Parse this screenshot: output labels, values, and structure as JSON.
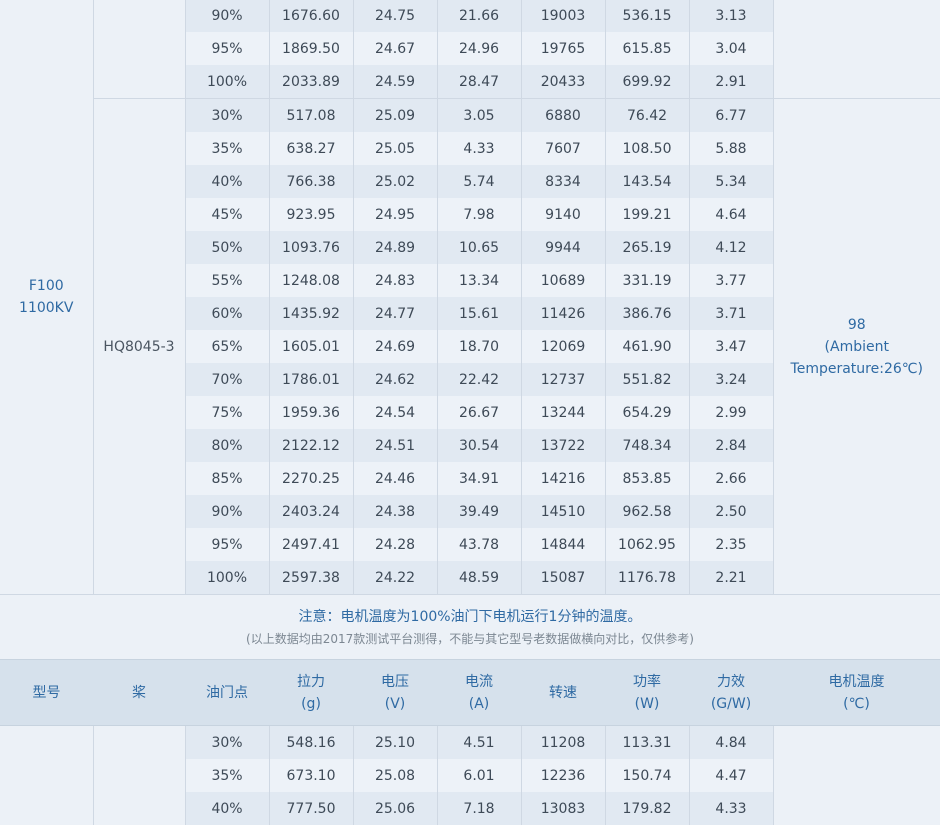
{
  "group1": {
    "motor_line1": "F100",
    "motor_line2": "1100KV",
    "rows_a": [
      {
        "throttle": "90%",
        "thrust": "1676.60",
        "voltage": "24.75",
        "current": "21.66",
        "rpm": "19003",
        "power": "536.15",
        "eff": "3.13"
      },
      {
        "throttle": "95%",
        "thrust": "1869.50",
        "voltage": "24.67",
        "current": "24.96",
        "rpm": "19765",
        "power": "615.85",
        "eff": "3.04"
      },
      {
        "throttle": "100%",
        "thrust": "2033.89",
        "voltage": "24.59",
        "current": "28.47",
        "rpm": "20433",
        "power": "699.92",
        "eff": "2.91"
      }
    ],
    "prop_b": "HQ8045-3",
    "temp_b_line1": "98",
    "temp_b_line2": "(Ambient",
    "temp_b_line3": "Temperature:26℃)",
    "rows_b": [
      {
        "throttle": "30%",
        "thrust": "517.08",
        "voltage": "25.09",
        "current": "3.05",
        "rpm": "6880",
        "power": "76.42",
        "eff": "6.77"
      },
      {
        "throttle": "35%",
        "thrust": "638.27",
        "voltage": "25.05",
        "current": "4.33",
        "rpm": "7607",
        "power": "108.50",
        "eff": "5.88"
      },
      {
        "throttle": "40%",
        "thrust": "766.38",
        "voltage": "25.02",
        "current": "5.74",
        "rpm": "8334",
        "power": "143.54",
        "eff": "5.34"
      },
      {
        "throttle": "45%",
        "thrust": "923.95",
        "voltage": "24.95",
        "current": "7.98",
        "rpm": "9140",
        "power": "199.21",
        "eff": "4.64"
      },
      {
        "throttle": "50%",
        "thrust": "1093.76",
        "voltage": "24.89",
        "current": "10.65",
        "rpm": "9944",
        "power": "265.19",
        "eff": "4.12"
      },
      {
        "throttle": "55%",
        "thrust": "1248.08",
        "voltage": "24.83",
        "current": "13.34",
        "rpm": "10689",
        "power": "331.19",
        "eff": "3.77"
      },
      {
        "throttle": "60%",
        "thrust": "1435.92",
        "voltage": "24.77",
        "current": "15.61",
        "rpm": "11426",
        "power": "386.76",
        "eff": "3.71"
      },
      {
        "throttle": "65%",
        "thrust": "1605.01",
        "voltage": "24.69",
        "current": "18.70",
        "rpm": "12069",
        "power": "461.90",
        "eff": "3.47"
      },
      {
        "throttle": "70%",
        "thrust": "1786.01",
        "voltage": "24.62",
        "current": "22.42",
        "rpm": "12737",
        "power": "551.82",
        "eff": "3.24"
      },
      {
        "throttle": "75%",
        "thrust": "1959.36",
        "voltage": "24.54",
        "current": "26.67",
        "rpm": "13244",
        "power": "654.29",
        "eff": "2.99"
      },
      {
        "throttle": "80%",
        "thrust": "2122.12",
        "voltage": "24.51",
        "current": "30.54",
        "rpm": "13722",
        "power": "748.34",
        "eff": "2.84"
      },
      {
        "throttle": "85%",
        "thrust": "2270.25",
        "voltage": "24.46",
        "current": "34.91",
        "rpm": "14216",
        "power": "853.85",
        "eff": "2.66"
      },
      {
        "throttle": "90%",
        "thrust": "2403.24",
        "voltage": "24.38",
        "current": "39.49",
        "rpm": "14510",
        "power": "962.58",
        "eff": "2.50"
      },
      {
        "throttle": "95%",
        "thrust": "2497.41",
        "voltage": "24.28",
        "current": "43.78",
        "rpm": "14844",
        "power": "1062.95",
        "eff": "2.35"
      },
      {
        "throttle": "100%",
        "thrust": "2597.38",
        "voltage": "24.22",
        "current": "48.59",
        "rpm": "15087",
        "power": "1176.78",
        "eff": "2.21"
      }
    ]
  },
  "note": {
    "line1": "注意：电机温度为100%油门下电机运行1分钟的温度。",
    "line2": "(以上数据均由2017款测试平台测得，不能与其它型号老数据做横向对比，仅供参考)"
  },
  "header": {
    "model": "型号",
    "prop": "桨",
    "throttle": "油门点",
    "thrust": "拉力",
    "thrust_unit": "(g)",
    "voltage": "电压",
    "voltage_unit": "(V)",
    "current": "电流",
    "current_unit": "(A)",
    "rpm": "转速",
    "power": "功率",
    "power_unit": "(W)",
    "eff": "力效",
    "eff_unit": "(G/W)",
    "temp": "电机温度",
    "temp_unit": "(℃)"
  },
  "group2": {
    "rows": [
      {
        "throttle": "30%",
        "thrust": "548.16",
        "voltage": "25.10",
        "current": "4.51",
        "rpm": "11208",
        "power": "113.31",
        "eff": "4.84"
      },
      {
        "throttle": "35%",
        "thrust": "673.10",
        "voltage": "25.08",
        "current": "6.01",
        "rpm": "12236",
        "power": "150.74",
        "eff": "4.47"
      },
      {
        "throttle": "40%",
        "thrust": "777.50",
        "voltage": "25.06",
        "current": "7.18",
        "rpm": "13083",
        "power": "179.82",
        "eff": "4.33"
      }
    ]
  }
}
